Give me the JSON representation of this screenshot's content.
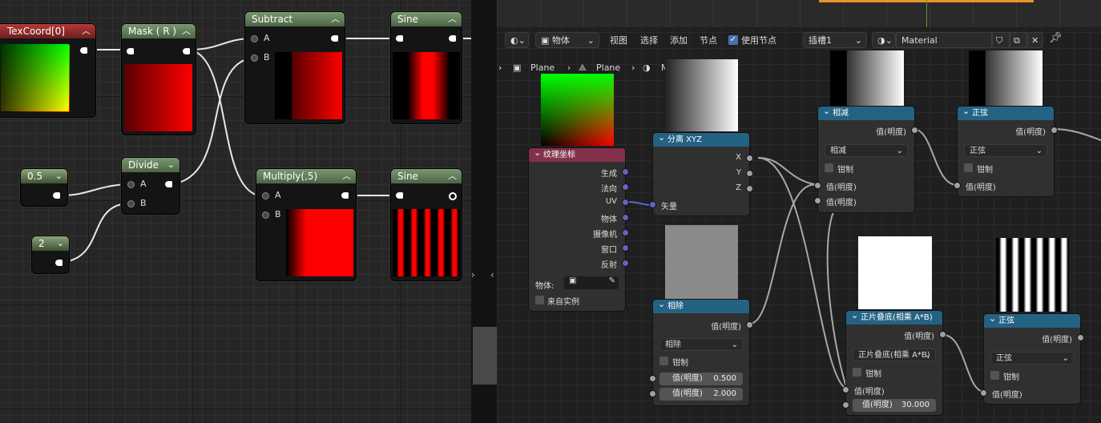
{
  "unreal": {
    "nodes": {
      "texcoord": {
        "title": "TexCoord[0]"
      },
      "mask": {
        "title": "Mask ( R )"
      },
      "subtract": {
        "title": "Subtract",
        "in_a": "A",
        "in_b": "B"
      },
      "sine1": {
        "title": "Sine"
      },
      "const_half": {
        "title": "0.5"
      },
      "divide": {
        "title": "Divide",
        "in_a": "A",
        "in_b": "B"
      },
      "multiply": {
        "title": "Multiply(,5)",
        "in_a": "A",
        "in_b": "B"
      },
      "sine2": {
        "title": "Sine"
      },
      "const_two": {
        "title": "2"
      }
    }
  },
  "blender": {
    "toolbar": {
      "mode_label": "物体",
      "view": "视图",
      "select": "选择",
      "add": "添加",
      "node": "节点",
      "use_nodes_label": "使用节点",
      "use_nodes_checked": true,
      "slot": "插槽1",
      "material_name": "Material"
    },
    "breadcrumb": [
      "Plane",
      "Plane",
      "M"
    ],
    "nodes": {
      "texcoord": {
        "title": "纹理坐标",
        "outputs": [
          "生成",
          "法向",
          "UV",
          "物体",
          "摄像机",
          "窗口",
          "反射"
        ],
        "object_label": "物体:",
        "from_instancer": "来自实例"
      },
      "separate": {
        "title": "分离 XYZ",
        "outputs": [
          "X",
          "Y",
          "Z"
        ],
        "input": "矢量"
      },
      "divide": {
        "title": "相除",
        "output": "值(明度)",
        "operation": "相除",
        "clamp": "钳制",
        "val1_label": "值(明度)",
        "val1": "0.500",
        "val2_label": "值(明度)",
        "val2": "2.000"
      },
      "subtract": {
        "title": "相减",
        "output": "值(明度)",
        "operation": "相减",
        "clamp": "钳制",
        "in1": "值(明度)",
        "in2": "值(明度)"
      },
      "sine1": {
        "title": "正弦",
        "output": "值(明度)",
        "operation": "正弦",
        "clamp": "钳制",
        "in1": "值(明度)"
      },
      "multiply": {
        "title": "正片叠底(相乘 A*B)",
        "output": "值(明度)",
        "operation": "正片叠底(相乘 A*B)",
        "clamp": "钳制",
        "in1": "值(明度)",
        "val2_label": "值(明度)",
        "val2": "30.000"
      },
      "sine2": {
        "title": "正弦",
        "output": "值(明度)",
        "operation": "正弦",
        "clamp": "钳制",
        "in1": "值(明度)"
      }
    }
  },
  "colors": {
    "ue_header_green": "#5d7a52",
    "ue_header_red": "#8c2a2a",
    "blender_header_blue": "#246283",
    "blender_header_pink": "#83314a"
  }
}
